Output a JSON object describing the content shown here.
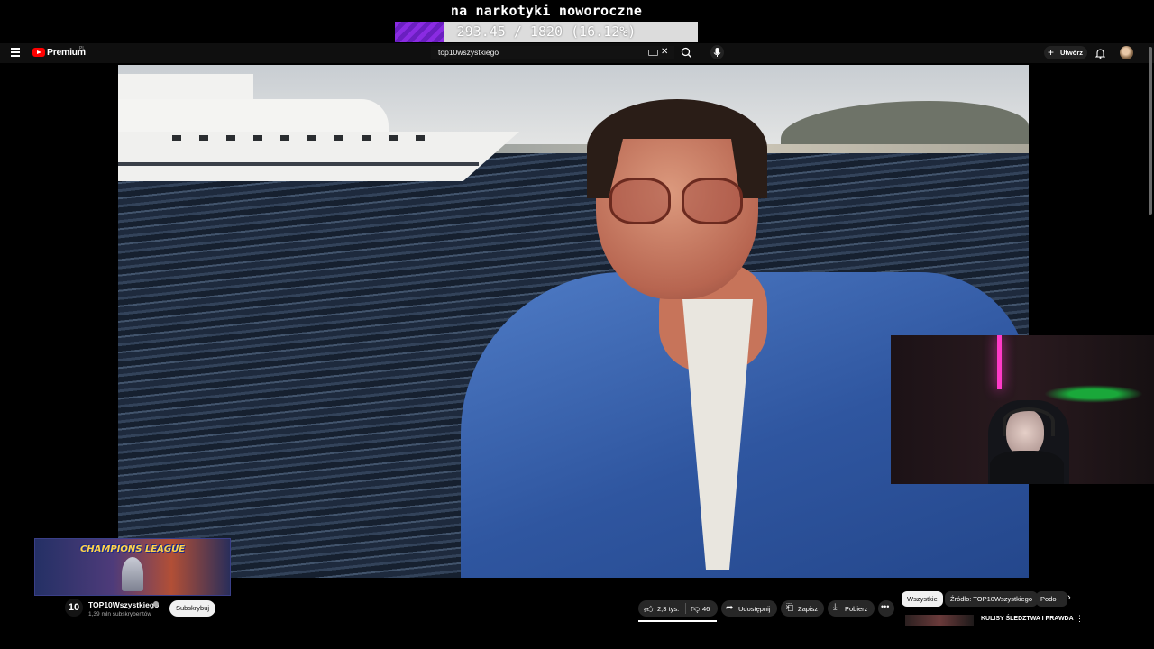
{
  "overlay": {
    "goal_title": "na narkotyki noworoczne",
    "goal_progress_text": "293.45 / 1820 (16.12%)",
    "goal_progress_fraction": 0.1612,
    "fill_color": "#8a2be2"
  },
  "header": {
    "logo_text": "Premium",
    "logo_region": "PL",
    "search_value": "top10wszystkiego",
    "create_label": "Utwórz",
    "icons": [
      "menu-icon",
      "youtube-logo-icon",
      "keyboard-icon",
      "close-icon",
      "search-icon",
      "mic-icon",
      "plus-icon",
      "bell-icon",
      "avatar"
    ]
  },
  "banner": {
    "text": "CHAMPIONS LEAGUE"
  },
  "channel": {
    "logo_text": "10",
    "name": "TOP10Wszystkiego",
    "subscribers": "1,39 mln subskrybentów",
    "subscribe_label": "Subskrybuj"
  },
  "actions": {
    "like_count": "2,3 tys.",
    "dislike_count": "46",
    "share_label": "Udostępnij",
    "save_label": "Zapisz",
    "download_label": "Pobierz",
    "more_icon": "ellipsis-icon"
  },
  "chips": {
    "all": "Wszystkie",
    "source": "Źródło: TOP10Wszystkiego",
    "partial": "Podo"
  },
  "related": {
    "title": "KULISY ŚLEDZTWA I PRAWDA"
  },
  "colors": {
    "youtube_red": "#ff0000",
    "background": "#0f0f0f",
    "pill": "#272727"
  }
}
